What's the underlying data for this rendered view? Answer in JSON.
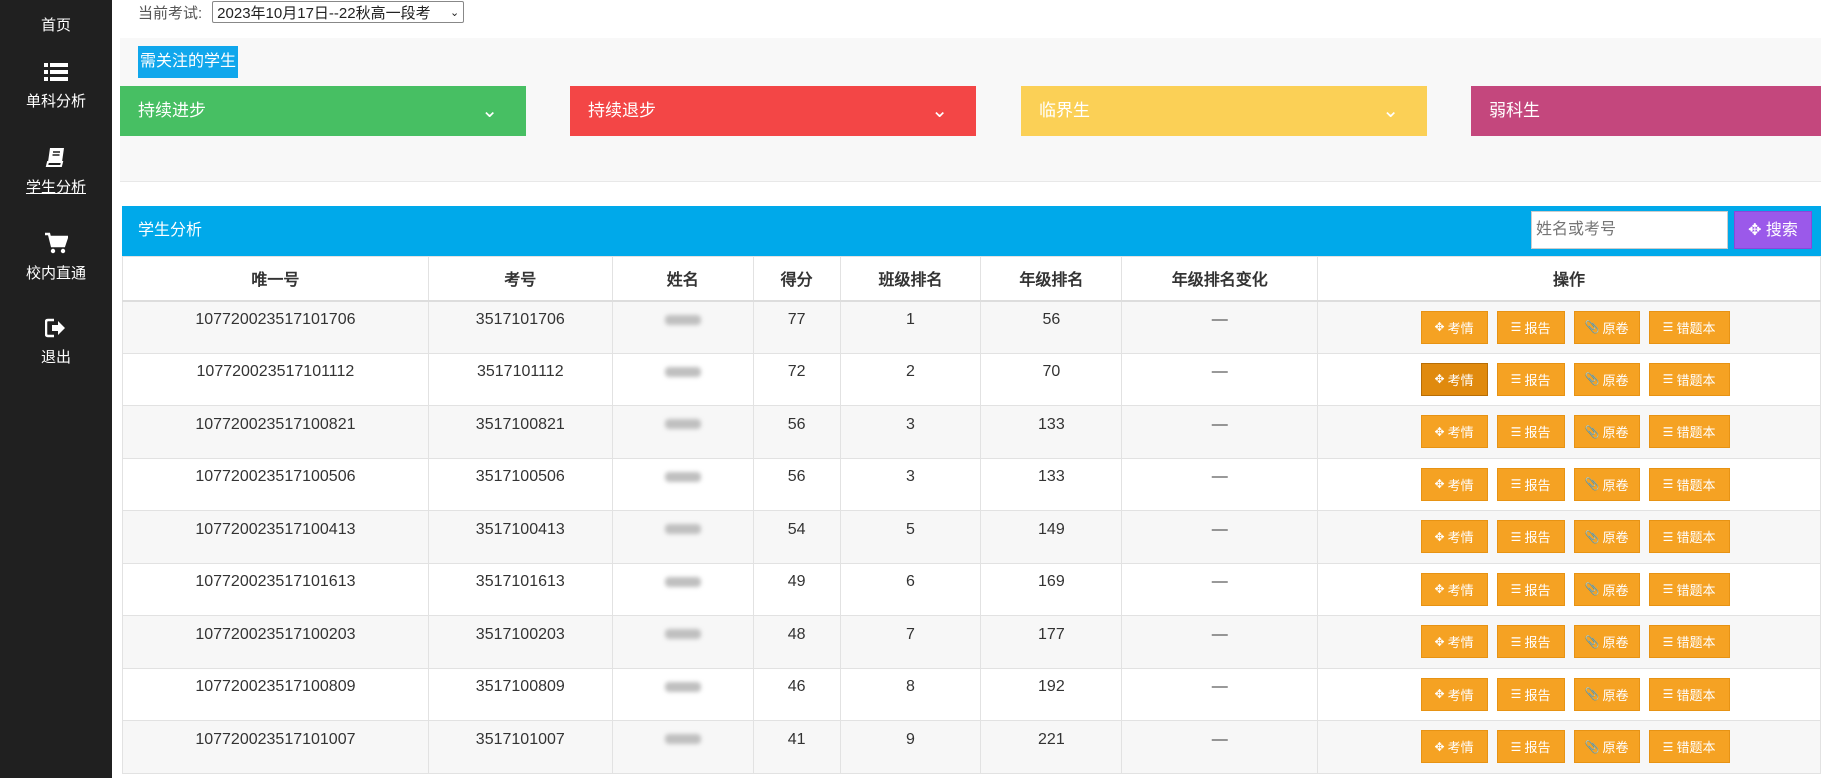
{
  "sidebar": {
    "items": [
      {
        "label": "首页",
        "icon": "home-icon"
      },
      {
        "label": "单科分析",
        "icon": "list-icon"
      },
      {
        "label": "学生分析",
        "icon": "book-icon"
      },
      {
        "label": "校内直通",
        "icon": "cart-icon"
      },
      {
        "label": "退出",
        "icon": "logout-icon"
      }
    ]
  },
  "exam": {
    "label": "当前考试:",
    "selected": "2023年10月17日--22秋高一段考"
  },
  "focus": {
    "title": "需关注的学生",
    "categories": [
      {
        "label": "持续进步",
        "color": "#47bf63"
      },
      {
        "label": "持续退步",
        "color": "#f34646"
      },
      {
        "label": "临界生",
        "color": "#fbd056"
      },
      {
        "label": "弱科生",
        "color": "#c4477d"
      }
    ]
  },
  "analysis": {
    "title": "学生分析",
    "search_placeholder": "姓名或考号",
    "search_label": "搜索",
    "columns": [
      "唯一号",
      "考号",
      "姓名",
      "得分",
      "班级排名",
      "年级排名",
      "年级排名变化",
      "操作"
    ],
    "actions": [
      "考情",
      "报告",
      "原卷",
      "错题本"
    ],
    "rows": [
      {
        "uid": "107720023517101706",
        "exam_no": "3517101706",
        "score": "77",
        "class_rank": "1",
        "grade_rank": "56",
        "change": "—"
      },
      {
        "uid": "107720023517101112",
        "exam_no": "3517101112",
        "score": "72",
        "class_rank": "2",
        "grade_rank": "70",
        "change": "—"
      },
      {
        "uid": "107720023517100821",
        "exam_no": "3517100821",
        "score": "56",
        "class_rank": "3",
        "grade_rank": "133",
        "change": "—"
      },
      {
        "uid": "107720023517100506",
        "exam_no": "3517100506",
        "score": "56",
        "class_rank": "3",
        "grade_rank": "133",
        "change": "—"
      },
      {
        "uid": "107720023517100413",
        "exam_no": "3517100413",
        "score": "54",
        "class_rank": "5",
        "grade_rank": "149",
        "change": "—"
      },
      {
        "uid": "107720023517101613",
        "exam_no": "3517101613",
        "score": "49",
        "class_rank": "6",
        "grade_rank": "169",
        "change": "—"
      },
      {
        "uid": "107720023517100203",
        "exam_no": "3517100203",
        "score": "48",
        "class_rank": "7",
        "grade_rank": "177",
        "change": "—"
      },
      {
        "uid": "107720023517100809",
        "exam_no": "3517100809",
        "score": "46",
        "class_rank": "8",
        "grade_rank": "192",
        "change": "—"
      },
      {
        "uid": "107720023517101007",
        "exam_no": "3517101007",
        "score": "41",
        "class_rank": "9",
        "grade_rank": "221",
        "change": "—"
      }
    ]
  }
}
